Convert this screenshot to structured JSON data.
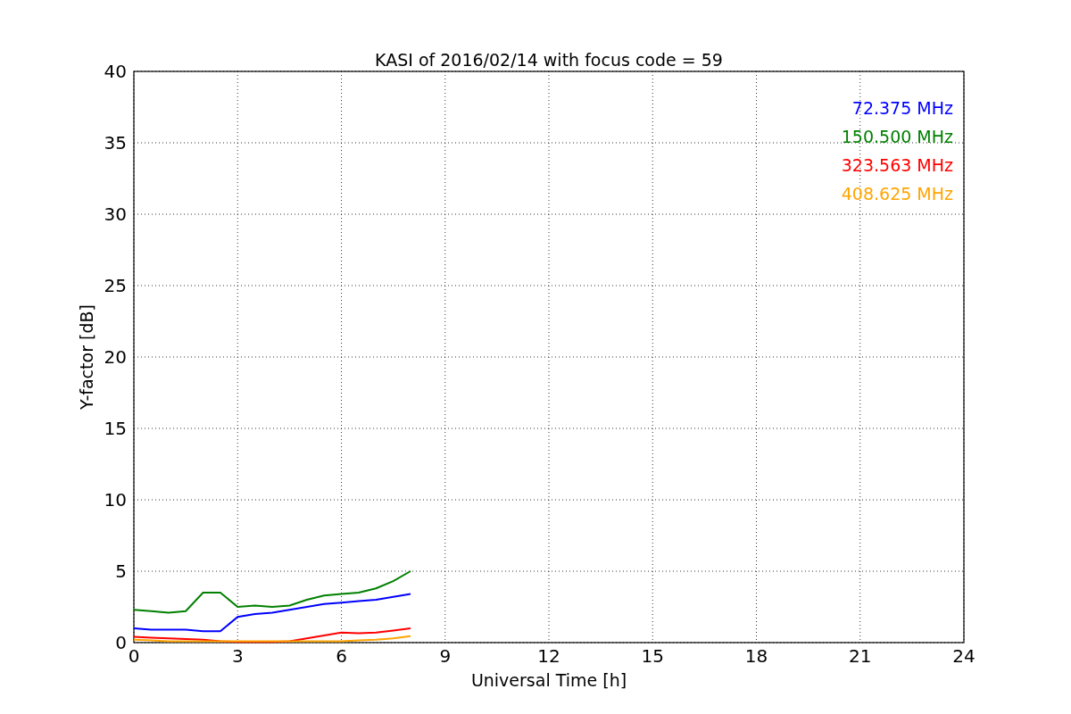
{
  "chart_data": {
    "type": "line",
    "title": "KASI of 2016/02/14 with focus code = 59",
    "xlabel": "Universal Time [h]",
    "ylabel": "Y-factor [dB]",
    "x": [
      0,
      0.5,
      1,
      1.5,
      2,
      2.5,
      3,
      3.5,
      4,
      4.5,
      5,
      5.5,
      6,
      6.5,
      7,
      7.5,
      8
    ],
    "series": [
      {
        "name": "72.375 MHz",
        "color": "#0000ff",
        "values": [
          1.0,
          0.9,
          0.9,
          0.9,
          0.8,
          0.8,
          1.8,
          2.0,
          2.1,
          2.3,
          2.5,
          2.7,
          2.8,
          2.9,
          3.0,
          3.2,
          3.4
        ]
      },
      {
        "name": "150.500 MHz",
        "color": "#008000",
        "values": [
          2.3,
          2.2,
          2.1,
          2.2,
          3.5,
          3.5,
          2.5,
          2.6,
          2.5,
          2.6,
          3.0,
          3.3,
          3.4,
          3.5,
          3.8,
          4.3,
          5.0
        ]
      },
      {
        "name": "323.563 MHz",
        "color": "#ff0000",
        "values": [
          0.4,
          0.35,
          0.3,
          0.25,
          0.2,
          0.1,
          0.05,
          0.05,
          0.05,
          0.1,
          0.3,
          0.5,
          0.7,
          0.65,
          0.7,
          0.85,
          1.0
        ]
      },
      {
        "name": "408.625 MHz",
        "color": "#ffa500",
        "values": [
          0.2,
          0.15,
          0.1,
          0.1,
          0.1,
          0.1,
          0.1,
          0.1,
          0.1,
          0.1,
          0.1,
          0.1,
          0.1,
          0.15,
          0.2,
          0.3,
          0.45
        ]
      }
    ],
    "grid": true,
    "xlim": [
      0,
      24
    ],
    "ylim": [
      0,
      40
    ],
    "xticks": [
      0,
      3,
      6,
      9,
      12,
      15,
      18,
      21,
      24
    ],
    "yticks": [
      0,
      5,
      10,
      15,
      20,
      25,
      30,
      35,
      40
    ]
  }
}
